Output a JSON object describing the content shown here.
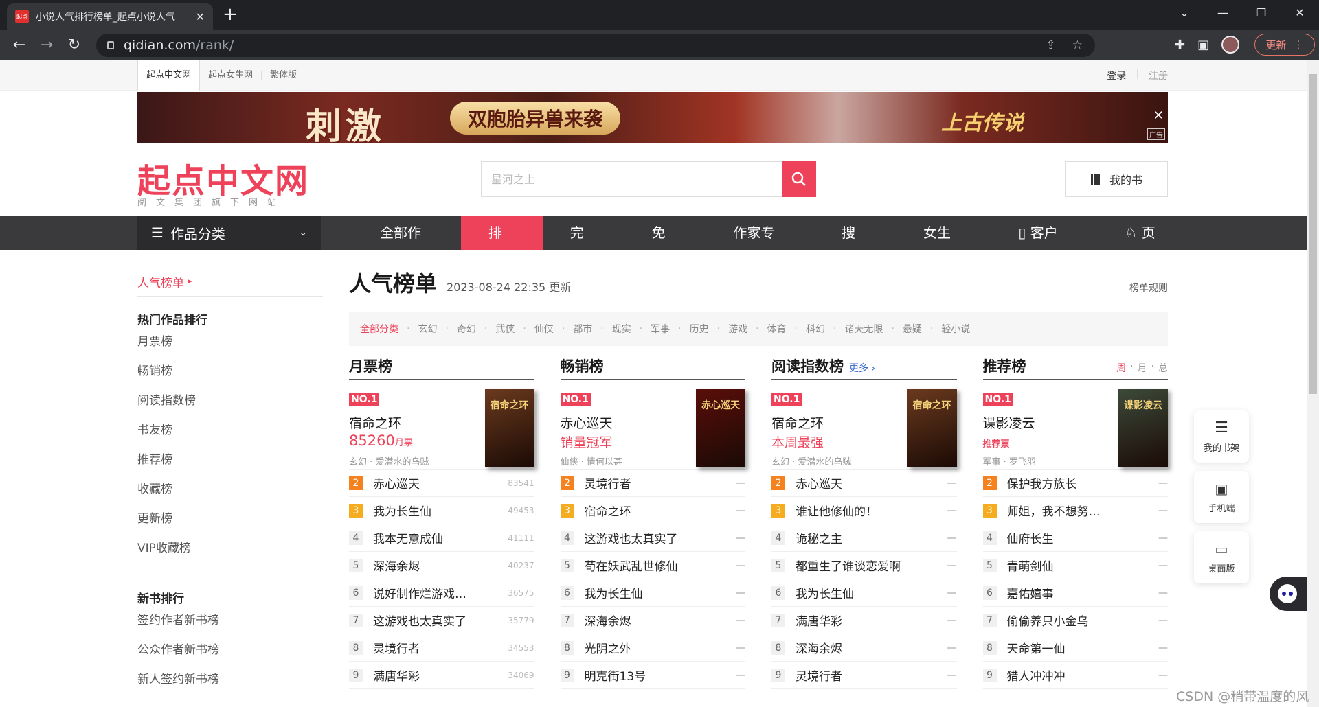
{
  "browser": {
    "tab_title": "小说人气排行榜单_起点小说人气",
    "favicon_text": "起点",
    "new_tab": "+",
    "url_host": "qidian.com",
    "url_path": "/rank/",
    "update_label": "更新"
  },
  "topbar": {
    "sites": [
      "起点中文网",
      "起点女生网",
      "繁体版"
    ],
    "login": "登录",
    "register": "注册"
  },
  "banner": {
    "headline": "刺激",
    "pill": "双胞胎异兽来袭",
    "game_logo": "上古传说",
    "ad_tag": "广告",
    "close": "✕"
  },
  "header": {
    "logo": "起点中文网",
    "logo_sub": "阅文集团旗下网站",
    "search_placeholder": "星河之上",
    "my_books": "我的书"
  },
  "nav": {
    "category_menu": "作品分类",
    "items": [
      "全部作品",
      "排行",
      "完本",
      "免费",
      "作家专区",
      "搜索",
      "女生网",
      "客户端",
      "页游"
    ],
    "active": "排行"
  },
  "sidebar": {
    "current": "人气榜单",
    "hot_head": "热门作品排行",
    "hot_links": [
      "月票榜",
      "畅销榜",
      "阅读指数榜",
      "书友榜",
      "推荐榜",
      "收藏榜",
      "更新榜",
      "VIP收藏榜"
    ],
    "new_head": "新书排行",
    "new_links": [
      "签约作者新书榜",
      "公众作者新书榜",
      "新人签约新书榜"
    ]
  },
  "main": {
    "title": "人气榜单",
    "updated": "2023-08-24 22:35 更新",
    "rules": "榜单规则",
    "filters": [
      "全部分类",
      "玄幻",
      "奇幻",
      "武侠",
      "仙侠",
      "都市",
      "现实",
      "军事",
      "历史",
      "游戏",
      "体育",
      "科幻",
      "诸天无限",
      "悬疑",
      "轻小说"
    ]
  },
  "columns": [
    {
      "title": "月票榜",
      "no1_badge": "NO.1",
      "top": {
        "name": "宿命之环",
        "stat": "85260",
        "stat_unit": "月票",
        "meta": "玄幻 · 爱潜水的乌贼",
        "cover_title": "宿命之环",
        "cover_color": "#6b3a1e"
      },
      "rows": [
        {
          "rank": "2",
          "name": "赤心巡天",
          "value": "83541"
        },
        {
          "rank": "3",
          "name": "我为长生仙",
          "value": "49453"
        },
        {
          "rank": "4",
          "name": "我本无意成仙",
          "value": "41111"
        },
        {
          "rank": "5",
          "name": "深海余烬",
          "value": "40237"
        },
        {
          "rank": "6",
          "name": "说好制作烂游戏…",
          "value": "36575"
        },
        {
          "rank": "7",
          "name": "这游戏也太真实了",
          "value": "35779"
        },
        {
          "rank": "8",
          "name": "灵境行者",
          "value": "34553"
        },
        {
          "rank": "9",
          "name": "满唐华彩",
          "value": "34069"
        }
      ]
    },
    {
      "title": "畅销榜",
      "no1_badge": "NO.1",
      "top": {
        "name": "赤心巡天",
        "stat": "销量冠军",
        "stat_unit": "",
        "meta": "仙侠 · 情何以甚",
        "cover_title": "赤心巡天",
        "cover_color": "#5a0e0a"
      },
      "rows": [
        {
          "rank": "2",
          "name": "灵境行者",
          "value": "—"
        },
        {
          "rank": "3",
          "name": "宿命之环",
          "value": "—"
        },
        {
          "rank": "4",
          "name": "这游戏也太真实了",
          "value": "—"
        },
        {
          "rank": "5",
          "name": "苟在妖武乱世修仙",
          "value": "—"
        },
        {
          "rank": "6",
          "name": "我为长生仙",
          "value": "—"
        },
        {
          "rank": "7",
          "name": "深海余烬",
          "value": "—"
        },
        {
          "rank": "8",
          "name": "光阴之外",
          "value": "—"
        },
        {
          "rank": "9",
          "name": "明克街13号",
          "value": "—"
        }
      ]
    },
    {
      "title": "阅读指数榜",
      "more": "更多 ›",
      "no1_badge": "NO.1",
      "top": {
        "name": "宿命之环",
        "stat": "本周最强",
        "stat_unit": "",
        "meta": "玄幻 · 爱潜水的乌贼",
        "cover_title": "宿命之环",
        "cover_color": "#6b3a1e"
      },
      "rows": [
        {
          "rank": "2",
          "name": "赤心巡天",
          "value": "—"
        },
        {
          "rank": "3",
          "name": "谁让他修仙的！",
          "value": "—"
        },
        {
          "rank": "4",
          "name": "诡秘之主",
          "value": "—"
        },
        {
          "rank": "5",
          "name": "都重生了谁谈恋爱啊",
          "value": "—"
        },
        {
          "rank": "6",
          "name": "我为长生仙",
          "value": "—"
        },
        {
          "rank": "7",
          "name": "满唐华彩",
          "value": "—"
        },
        {
          "rank": "8",
          "name": "深海余烬",
          "value": "—"
        },
        {
          "rank": "9",
          "name": "灵境行者",
          "value": "—"
        }
      ]
    },
    {
      "title": "推荐榜",
      "period": [
        "周",
        "月",
        "总"
      ],
      "no1_badge": "NO.1",
      "top": {
        "name": "谍影凌云",
        "stat": "推荐票",
        "stat_unit": "",
        "meta": "军事 · 罗飞羽",
        "cover_title": "谍影凌云",
        "cover_color": "#3d4a3a"
      },
      "rows": [
        {
          "rank": "2",
          "name": "保护我方族长",
          "value": "—"
        },
        {
          "rank": "3",
          "name": "师姐，我不想努…",
          "value": "—"
        },
        {
          "rank": "4",
          "name": "仙府长生",
          "value": "—"
        },
        {
          "rank": "5",
          "name": "青萌剑仙",
          "value": "—"
        },
        {
          "rank": "6",
          "name": "嘉佑嬉事",
          "value": "—"
        },
        {
          "rank": "7",
          "name": "偷偷养只小金乌",
          "value": "—"
        },
        {
          "rank": "8",
          "name": "天命第一仙",
          "value": "—"
        },
        {
          "rank": "9",
          "name": "猎人冲冲冲",
          "value": "—"
        }
      ]
    }
  ],
  "float": {
    "bookshelf": "我的书架",
    "mobile": "手机端",
    "desktop": "桌面版"
  },
  "watermark": "CSDN @稍带温度的风"
}
